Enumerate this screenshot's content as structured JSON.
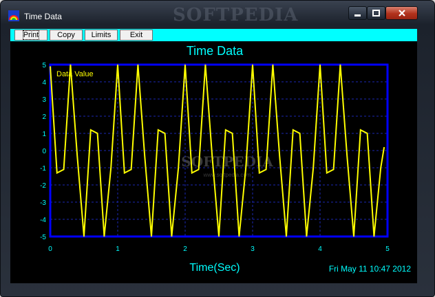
{
  "window": {
    "title": "Time Data",
    "watermark": "SOFTPEDIA",
    "watermark_url": "www.softpedia.com"
  },
  "toolbar": {
    "print_label": "Print",
    "copy_label": "Copy",
    "limits_label": "Limits",
    "exit_label": "Exit"
  },
  "colors": {
    "toolbar_bg": "#00ffff",
    "plot_bg": "#000000",
    "frame": "#0000ff",
    "grid": "#1c28b4",
    "trace": "#ffff00",
    "text": "#00ffff"
  },
  "chart_data": {
    "type": "line",
    "title": "Time Data",
    "xlabel": "Time(Sec)",
    "ylabel": "",
    "xlim": [
      0,
      5
    ],
    "ylim": [
      -5,
      5
    ],
    "xticks": [
      "0",
      "1",
      "2",
      "3",
      "4",
      "5"
    ],
    "yticks": [
      "5",
      "4",
      "3",
      "2",
      "1",
      "0",
      "-1",
      "-2",
      "-3",
      "-4",
      "-5"
    ],
    "grid": true,
    "legend": "top-left",
    "timestamp": "Fri May 11 10:47 2012",
    "series": [
      {
        "name": "Data Value",
        "x": [
          0,
          0.1,
          0.2,
          0.3,
          0.4,
          0.5,
          0.6,
          0.7,
          0.8,
          0.9,
          1.0,
          1.1,
          1.2,
          1.3,
          1.4,
          1.5,
          1.6,
          1.7,
          1.8,
          1.9,
          2.0,
          2.1,
          2.2,
          2.3,
          2.4,
          2.5,
          2.6,
          2.7,
          2.8,
          2.9,
          3.0,
          3.1,
          3.2,
          3.3,
          3.4,
          3.5,
          3.6,
          3.7,
          3.8,
          3.9,
          4.0,
          4.1,
          4.2,
          4.3,
          4.4,
          4.5,
          4.6,
          4.7,
          4.8,
          4.9,
          4.95
        ],
        "values": [
          4.9,
          -1.3,
          -1.1,
          5.0,
          -0.3,
          -5.0,
          1.2,
          1.0,
          -5.0,
          -1.0,
          5.0,
          -1.3,
          -1.1,
          5.0,
          -0.3,
          -5.0,
          1.2,
          1.0,
          -5.0,
          -1.0,
          5.0,
          -1.3,
          -1.1,
          5.0,
          -0.3,
          -5.0,
          1.2,
          1.0,
          -5.0,
          -1.0,
          5.0,
          -1.3,
          -1.1,
          5.0,
          -0.3,
          -5.0,
          1.2,
          1.0,
          -5.0,
          -1.0,
          5.0,
          -1.3,
          -1.1,
          5.0,
          -0.3,
          -5.0,
          1.2,
          1.0,
          -5.0,
          -1.0,
          0.2
        ]
      }
    ]
  }
}
